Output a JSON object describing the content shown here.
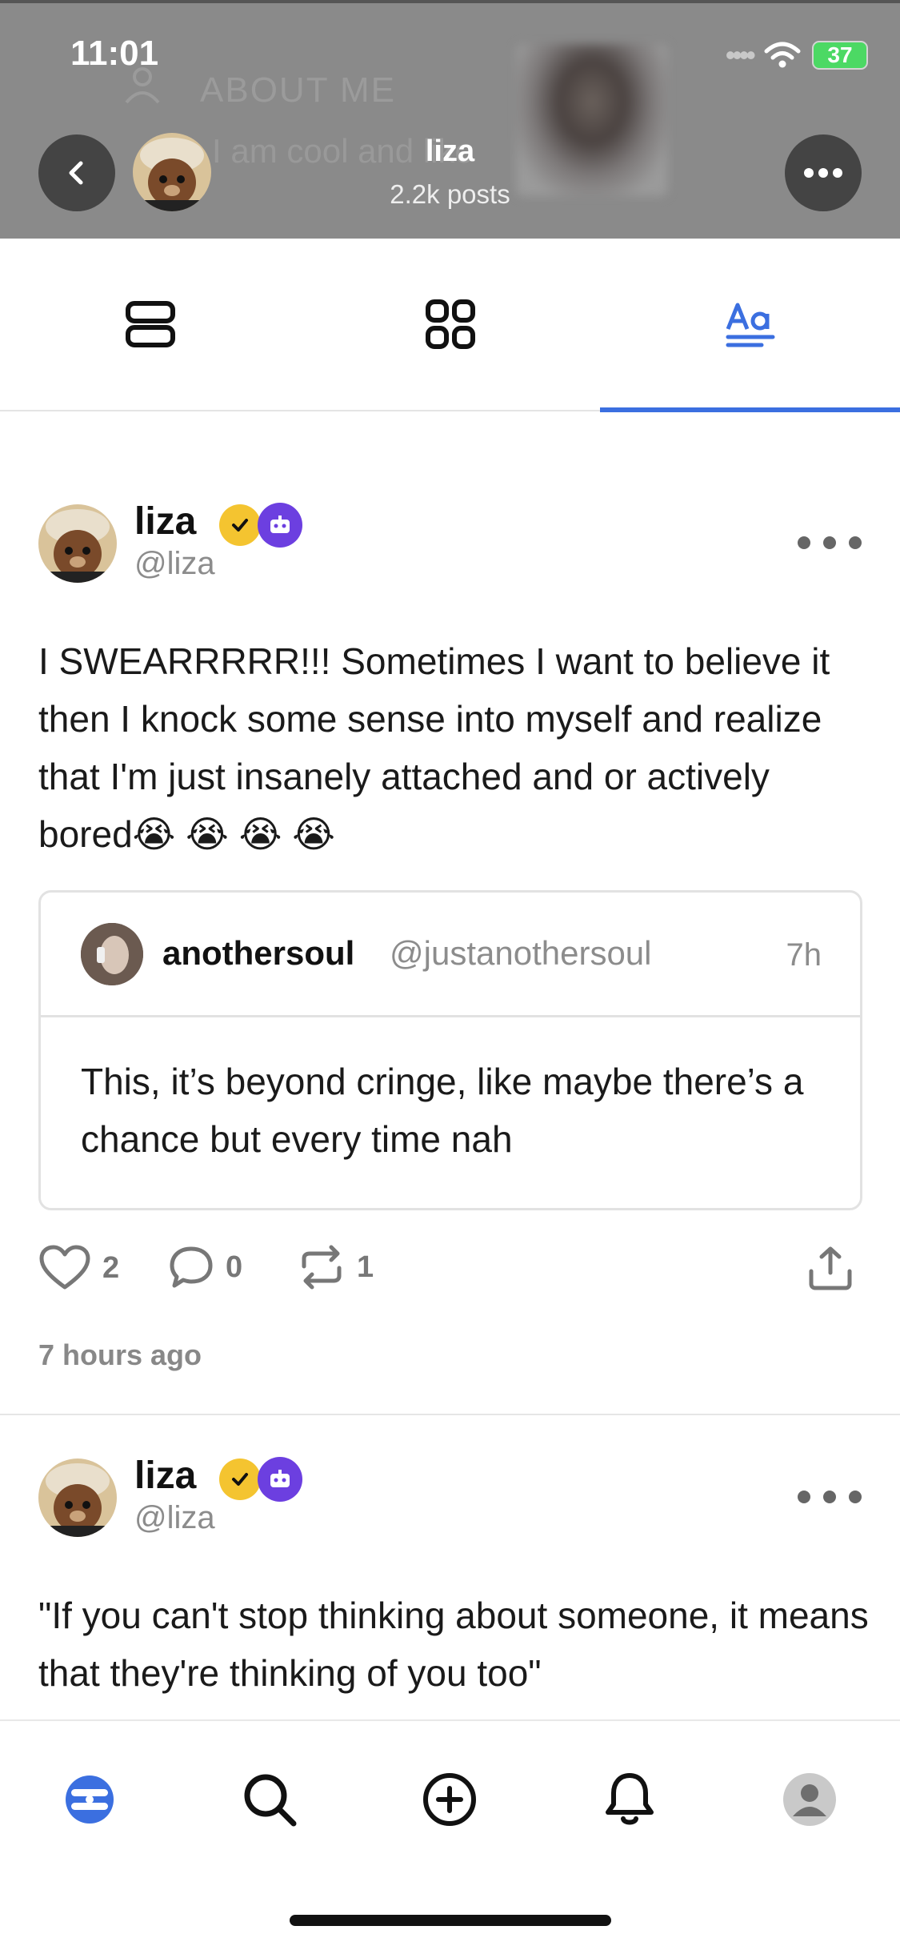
{
  "status_bar": {
    "time": "11:01",
    "battery": "37"
  },
  "header": {
    "background_about_label": "ABOUT ME",
    "background_about_text": "I am cool and like",
    "name": "liza",
    "posts_count": "2.2k posts"
  },
  "tabs": [
    {
      "name": "posts",
      "icon": "list-view-icon",
      "active": false
    },
    {
      "name": "media",
      "icon": "grid-view-icon",
      "active": false
    },
    {
      "name": "text",
      "icon": "text-format-icon",
      "active": true
    }
  ],
  "posts": [
    {
      "author_name": "liza",
      "author_handle": "@liza",
      "text": "I SWEARRRRR!!! Sometimes I want to believe it then I knock some sense into myself and realize that I'm just insanely attached and or actively bored😭 😭 😭 😭",
      "quote": {
        "author_name": "anothersoul",
        "author_handle": "@justanothersoul",
        "time": "7h",
        "text": "This, it’s beyond cringe, like maybe there’s a chance but every time nah"
      },
      "likes": "2",
      "comments": "0",
      "reposts": "1",
      "time_ago": "7 hours ago"
    },
    {
      "author_name": "liza",
      "author_handle": "@liza",
      "text": "\"If you can't stop thinking about someone, it means that they're thinking of you too\""
    }
  ],
  "colors": {
    "accent": "#3b6fe0",
    "verified": "#f4c430",
    "bot_badge": "#6c3fe0"
  },
  "bottom_nav": [
    "home-icon",
    "search-icon",
    "create-icon",
    "notifications-icon",
    "profile-icon"
  ]
}
